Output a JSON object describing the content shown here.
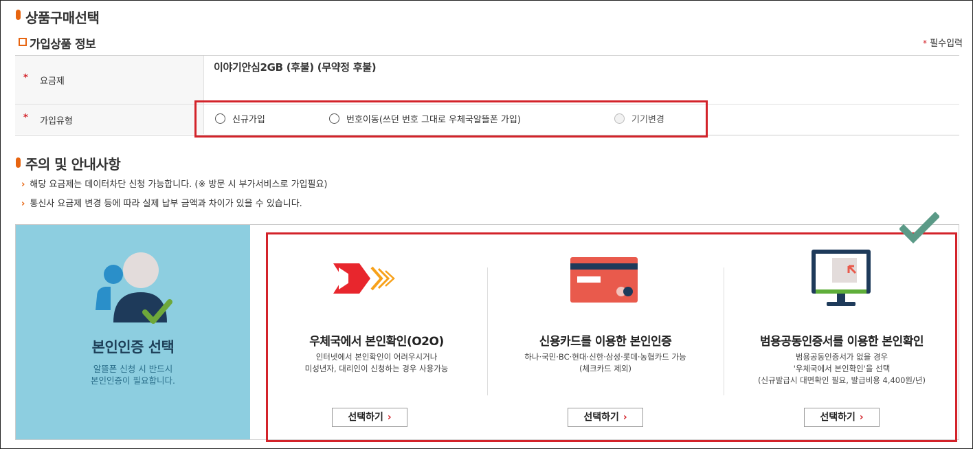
{
  "page": {
    "title": "상품구매선택",
    "section_subscription": "가입상품 정보",
    "required_note": "필수입력"
  },
  "plan_table": {
    "rows": [
      {
        "label": "요금제",
        "value": "이야기안심2GB (후불) (무약정 후불)"
      },
      {
        "label": "가입유형"
      }
    ],
    "join_types": [
      {
        "label": "신규가입",
        "disabled": false
      },
      {
        "label": "번호이동(쓰던 번호 그대로 우체국알뜰폰 가입)",
        "disabled": false
      },
      {
        "label": "기기변경",
        "disabled": true
      }
    ]
  },
  "notice": {
    "title": "주의 및 안내사항",
    "items": [
      "해당 요금제는 데이터차단 신청 가능합니다. (※ 방문 시 부가서비스로 가입필요)",
      "통신사 요금제 변경 등에 따라 실제 납부 금액과 차이가 있을 수 있습니다."
    ]
  },
  "auth": {
    "title": "본인인증 선택",
    "subtitle_lines": [
      "알뜰폰 신청 시 반드시",
      "본인인증이 필요합니다."
    ],
    "options": [
      {
        "icon": "post-office-logo-icon",
        "title": "우체국에서 본인확인(O2O)",
        "desc": [
          "인터넷에서 본인확인이 어려우시거나",
          "미성년자, 대리인이 신청하는 경우 사용가능"
        ],
        "button": "선택하기"
      },
      {
        "icon": "credit-card-icon",
        "title": "신용카드를 이용한 본인인증",
        "desc": [
          "하나·국민·BC·현대·신한·삼성·롯데·농협카드 가능",
          "(체크카드 제외)"
        ],
        "button": "선택하기"
      },
      {
        "icon": "monitor-certificate-icon",
        "title": "범용공동인증서를 이용한 본인확인",
        "desc": [
          "범용공동인증서가 없을 경우",
          "'우체국에서 본인확인'을 선택",
          "(신규발급시 대면확인 필요, 발급비용 4,400원/년)"
        ],
        "button": "선택하기"
      }
    ]
  },
  "colors": {
    "accent_orange": "#e7640f",
    "highlight_red": "#d3232a",
    "auth_panel_bg": "#8dcee0",
    "check_green": "#5b9a87"
  }
}
